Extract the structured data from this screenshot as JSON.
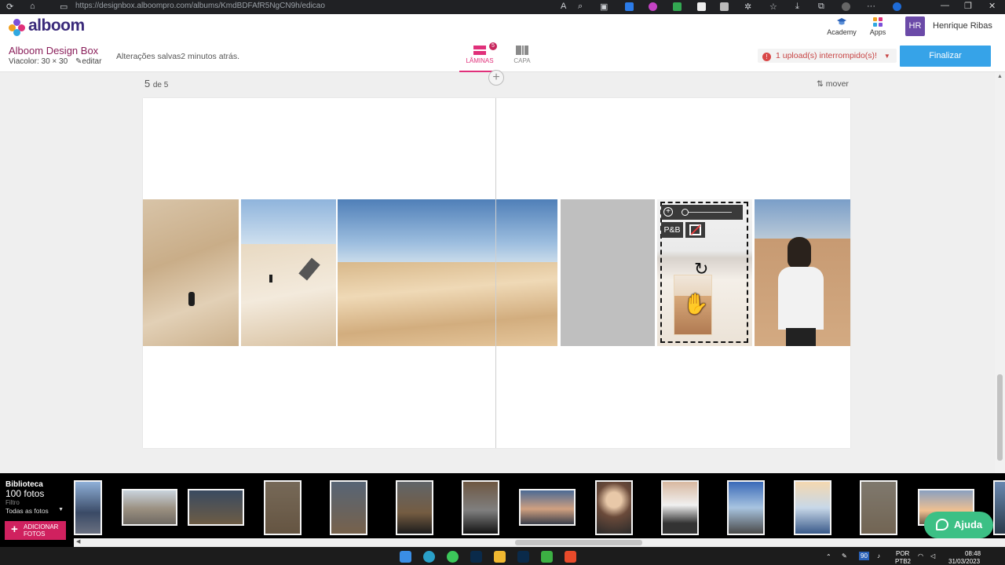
{
  "browser": {
    "url": "https://designbox.alboompro.com/albums/KmdBDFAfR5NgCN9h/edicao"
  },
  "header": {
    "logo_text": "alboom",
    "links": [
      {
        "label": "Academy",
        "icon": "academy-icon"
      },
      {
        "label": "Apps",
        "icon": "apps-grid-icon"
      }
    ],
    "user": {
      "initials": "HR",
      "name": "Henrique Ribas"
    }
  },
  "toolbar": {
    "project_title": "Alboom Design Box",
    "project_subtitle": "Viacolor: 30 × 30",
    "edit_label": "editar",
    "save_status": "Alterações salvas2 minutos atrás.",
    "tabs": [
      {
        "label": "LÂMINAS",
        "badge": "5",
        "active": true,
        "icon": "pages-icon"
      },
      {
        "label": "CAPA",
        "active": false,
        "icon": "cover-icon"
      }
    ],
    "upload_warning": "1 upload(s) interrompido(s)!",
    "finish_label": "Finalizar"
  },
  "editor": {
    "page_current": "5",
    "page_of": "de 5",
    "move_label": "mover",
    "selected_slot": {
      "bw_label": "P&B",
      "zoom_fraction": 0.0
    }
  },
  "library": {
    "title": "Biblioteca",
    "count": "100 fotos",
    "filter_label": "Filtro",
    "filter_value": "Todas as fotos",
    "add_label_line1": "ADICIONAR",
    "add_label_line2": "FOTOS"
  },
  "help_label": "Ajuda",
  "taskbar": {
    "lang_top": "POR",
    "lang_bottom": "PTB2",
    "battery": "90",
    "time": "08:48",
    "date": "31/03/2023"
  },
  "colors": {
    "brand_purple": "#3a2a7a",
    "brand_pink": "#e0307a",
    "finish_blue": "#36a3e8",
    "help_green": "#3cc085",
    "warning_red": "#d94848"
  }
}
